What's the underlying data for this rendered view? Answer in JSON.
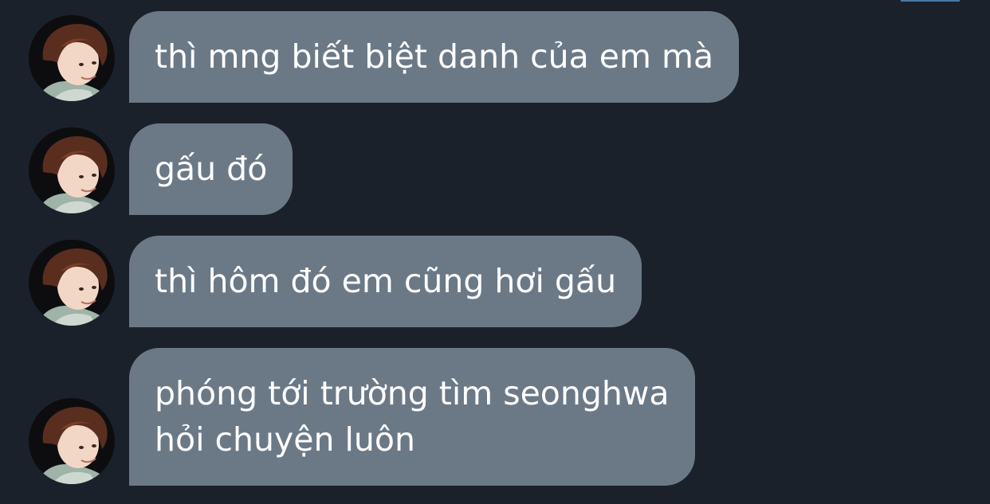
{
  "thread": {
    "messages": [
      {
        "text": "thì mng biết biệt danh của em mà",
        "avatar": "sender-avatar"
      },
      {
        "text": "gấu đó",
        "avatar": "sender-avatar"
      },
      {
        "text": "thì hôm đó em cũng hơi gấu",
        "avatar": "sender-avatar"
      },
      {
        "text": "phóng tới trường tìm seonghwa\nhỏi chuyện luôn",
        "avatar": "sender-avatar"
      }
    ]
  },
  "colors": {
    "background": "#1b212b",
    "bubble": "#6b7987",
    "text": "#ffffff",
    "indicator": "#4a78a8"
  }
}
